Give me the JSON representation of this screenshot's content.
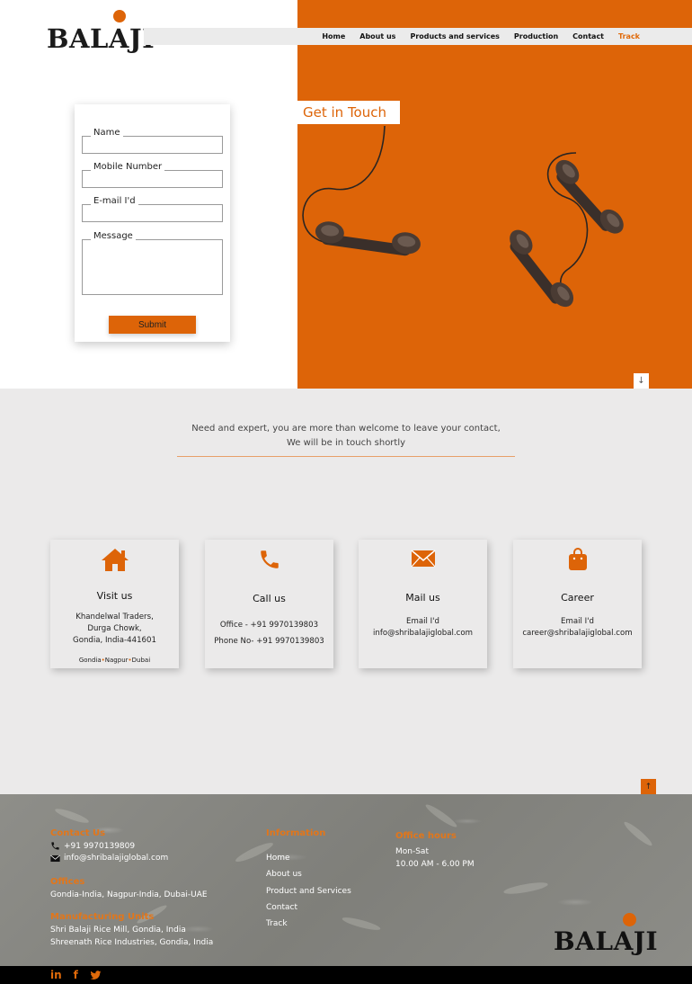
{
  "brand": {
    "name": "BALAJI"
  },
  "nav": {
    "items": [
      {
        "label": "Home",
        "active": false
      },
      {
        "label": "About us",
        "active": false
      },
      {
        "label": "Products and services",
        "active": false
      },
      {
        "label": "Production",
        "active": false
      },
      {
        "label": "Contact",
        "active": false
      },
      {
        "label": "Track",
        "active": true
      }
    ]
  },
  "form": {
    "name_label": "Name",
    "mobile_label": "Mobile Number",
    "email_label": "E-mail I'd",
    "message_label": "Message",
    "submit_label": "Submit"
  },
  "hero": {
    "get_in_touch": "Get in Touch"
  },
  "contact": {
    "tagline_line1": "Need and expert, you are more than welcome to leave your contact,",
    "tagline_line2": "We will be in touch shortly",
    "cards": [
      {
        "icon": "home-icon",
        "title": "Visit us",
        "lines": [
          "Khandelwal Traders,",
          "Durga Chowk,",
          "Gondia, India-441601"
        ],
        "cities": [
          "Gondia",
          "Nagpur",
          "Dubai"
        ]
      },
      {
        "icon": "phone-icon",
        "title": "Call us",
        "lines": [
          "Office - +91 9970139803",
          "Phone No- +91 9970139803"
        ]
      },
      {
        "icon": "mail-icon",
        "title": "Mail us",
        "lines": [
          "Email I'd",
          "info@shribalajiglobal.com"
        ]
      },
      {
        "icon": "bag-icon",
        "title": "Career",
        "lines": [
          "Email I'd",
          "career@shribalajiglobal.com"
        ]
      }
    ]
  },
  "footer": {
    "contact_title": "Contact Us",
    "phone": "+91 9970139809",
    "email": "info@shribalajiglobal.com",
    "offices_title": "Offices",
    "offices_text": "Gondia-India, Nagpur-India, Dubai-UAE",
    "units_title": "Manufacturing Units",
    "units": [
      "Shri Balaji Rice Mill, Gondia, India",
      "Shreenath Rice Industries, Gondia, India"
    ],
    "information_title": "Information",
    "links": [
      "Home",
      "About us",
      "Product and Services",
      "Contact",
      "Track"
    ],
    "hours_title": "Office hours",
    "hours_days": "Mon-Sat",
    "hours_time": "10.00 AM - 6.00 PM"
  },
  "social": {
    "linkedin": "in",
    "facebook": "f"
  },
  "colors": {
    "accent": "#dd6408",
    "section_bg": "#ebeaea"
  }
}
